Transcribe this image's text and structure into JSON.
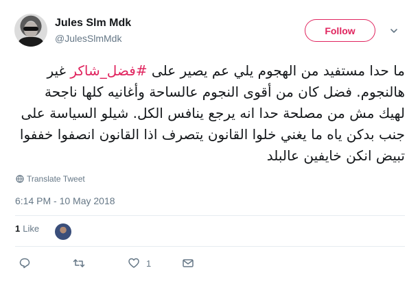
{
  "author": {
    "name": "Jules Slm Mdk",
    "handle": "@JulesSlmMdk"
  },
  "follow_button": {
    "label": "Follow",
    "color": "#e0245e"
  },
  "tweet": {
    "hashtag": "#فضل_شاكر",
    "text_before_hashtag": "ما حدا مستفيد من الهجوم يلي عم يصير على ",
    "text_after_hashtag": " غير هالنجوم. فضل كان من أقوى النجوم عالساحة وأغانيه كلها ناجحة لهيك مش من مصلحة حدا انه يرجع ينافس الكل. شيلو السياسة على جنب بدكن ياه ما يغني خلوا القانون يتصرف اذا القانون انصفوا خففوا تبيض انكن خايفين عالبلد"
  },
  "translate_label": "Translate Tweet",
  "timestamp": "6:14 PM - 10 May 2018",
  "stats": {
    "likes_count": "1",
    "likes_label": "Like"
  },
  "actions": {
    "like_count": "1"
  },
  "icons": [
    "chevron-down-icon",
    "globe-icon",
    "reply-icon",
    "retweet-icon",
    "heart-icon",
    "envelope-icon"
  ],
  "colors": {
    "text": "#14171a",
    "secondary": "#657786",
    "accent": "#e0245e",
    "divider": "#e6ecf0"
  }
}
